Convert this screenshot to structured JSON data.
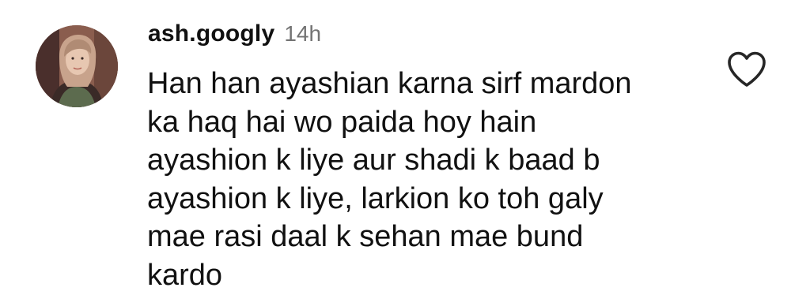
{
  "comment": {
    "username": "ash.googly",
    "timestamp": "14h",
    "text": "Han han ayashian karna sirf mardon\nka haq hai wo paida hoy hain\nayashion k liye aur shadi k baad b\nayashion k liye, larkion ko toh galy\nmae rasi daal k sehan mae bund\nkardo",
    "avatar_icon": "profile-photo",
    "like_icon": "heart-outline-icon"
  },
  "colors": {
    "text": "#111111",
    "timestamp": "#737373",
    "background": "#ffffff",
    "icon_stroke": "#262626"
  }
}
